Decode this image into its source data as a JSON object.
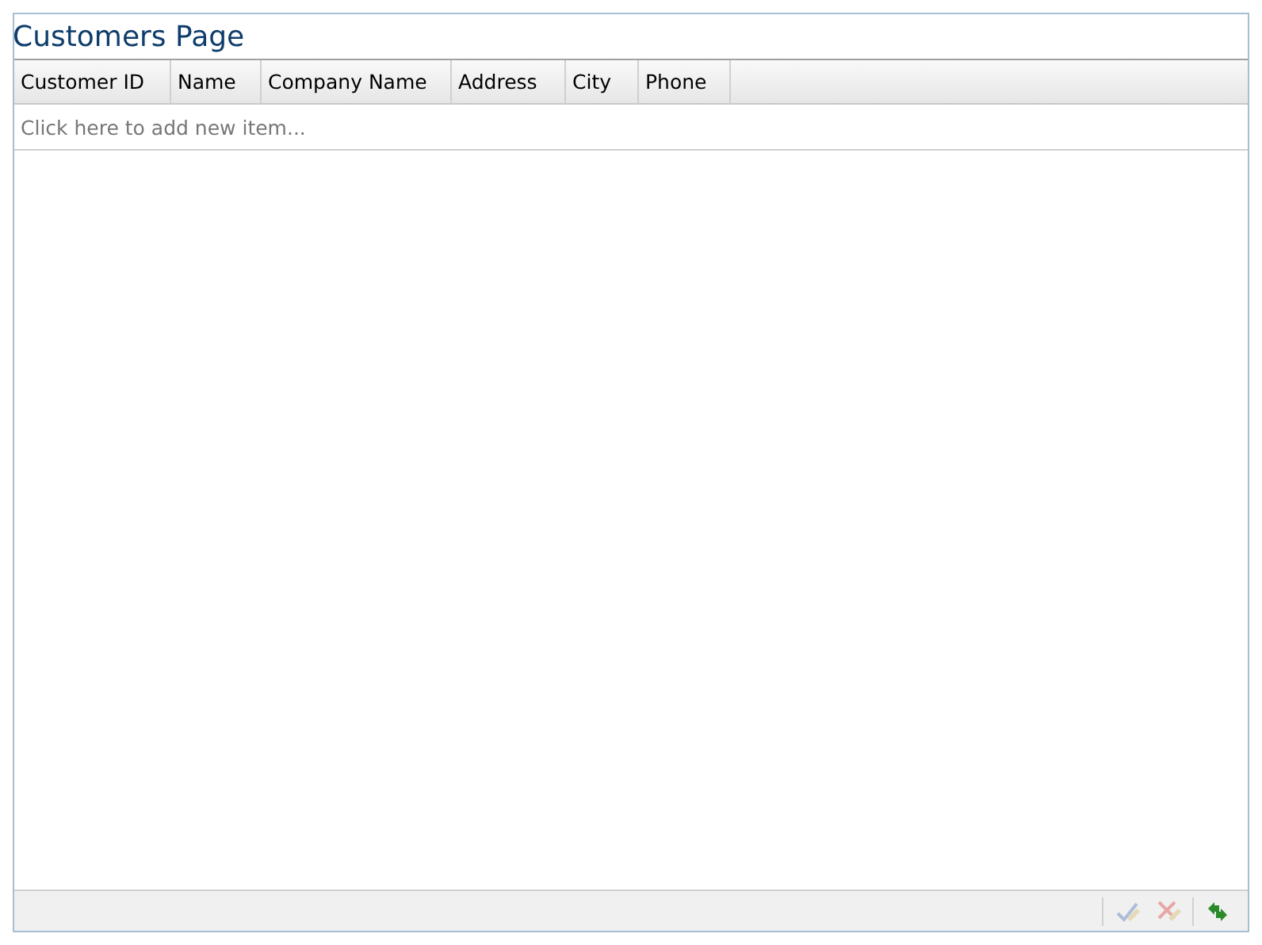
{
  "title": "Customers Page",
  "columns": [
    {
      "label": "Customer ID"
    },
    {
      "label": "Name"
    },
    {
      "label": "Company Name"
    },
    {
      "label": "Address"
    },
    {
      "label": "City"
    },
    {
      "label": "Phone"
    }
  ],
  "add_row": "Click here to add new item...",
  "toolbar": [
    {
      "kind": "save",
      "disabled": true
    },
    {
      "kind": "cancel",
      "disabled": true
    },
    {
      "kind": "refresh",
      "disabled": false
    }
  ]
}
